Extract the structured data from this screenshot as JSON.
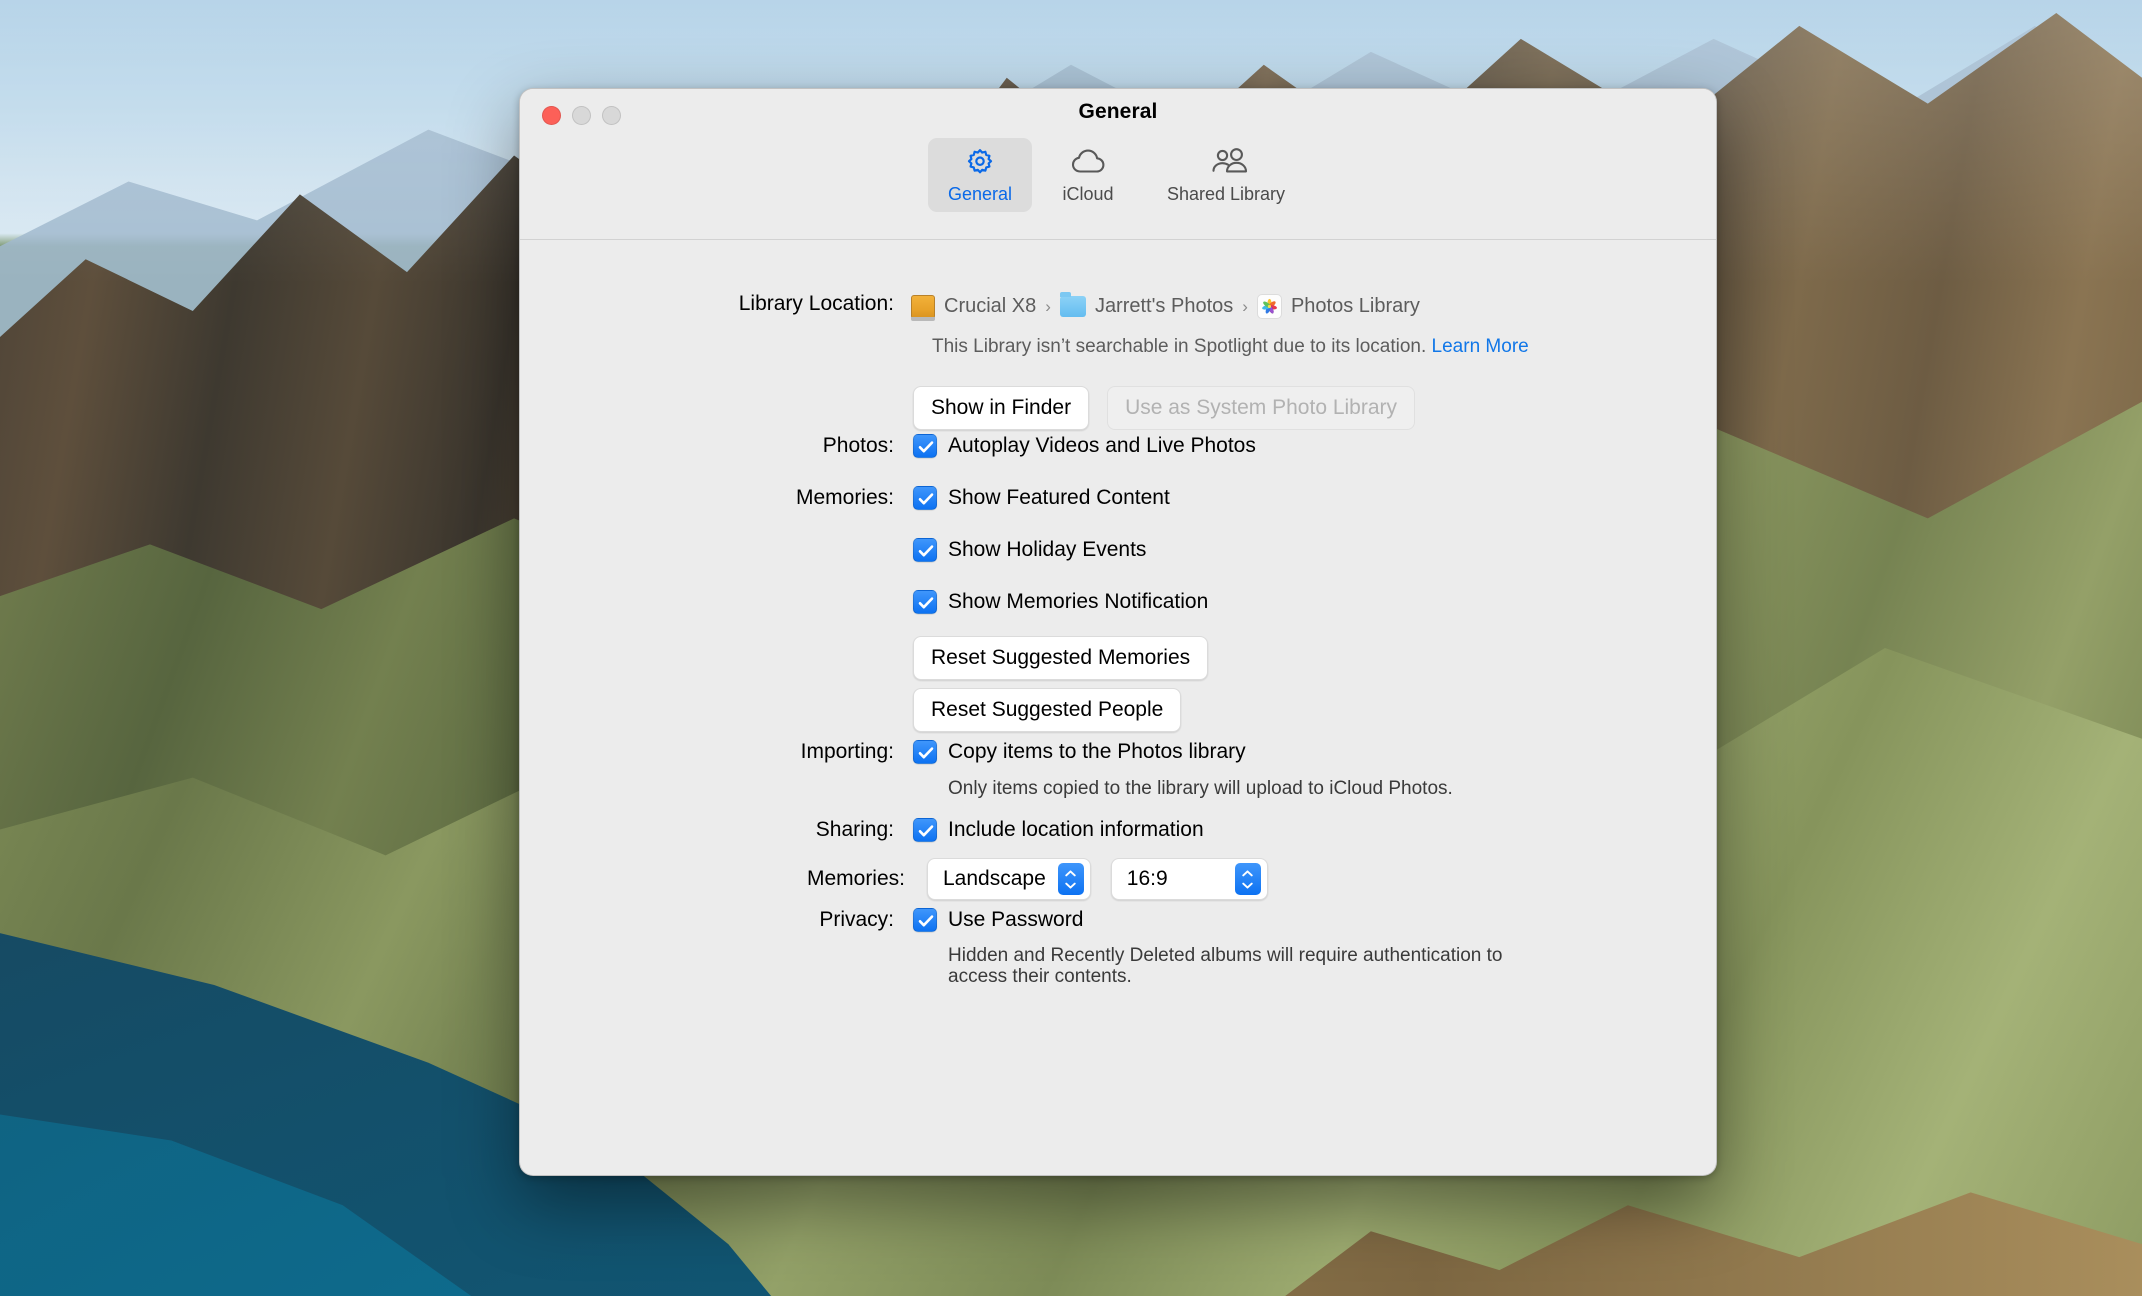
{
  "window": {
    "title": "General",
    "traffic_lights": [
      "close",
      "minimize",
      "zoom"
    ]
  },
  "toolbar": {
    "tabs": [
      {
        "id": "general",
        "label": "General",
        "icon": "gear-icon",
        "selected": true
      },
      {
        "id": "icloud",
        "label": "iCloud",
        "icon": "cloud-icon",
        "selected": false
      },
      {
        "id": "shared-library",
        "label": "Shared Library",
        "icon": "people-icon",
        "selected": false
      }
    ]
  },
  "library_location": {
    "label": "Library Location:",
    "breadcrumb": [
      {
        "name": "Crucial X8",
        "icon": "external-drive-icon"
      },
      {
        "name": "Jarrett's Photos",
        "icon": "folder-icon"
      },
      {
        "name": "Photos Library",
        "icon": "photos-app-icon"
      }
    ],
    "separator": "›",
    "note": "This Library isn’t searchable in Spotlight due to its location.",
    "note_link": "Learn More",
    "buttons": {
      "show_in_finder": "Show in Finder",
      "use_as_system": "Use as System Photo Library",
      "use_as_system_disabled": true
    }
  },
  "photos": {
    "label": "Photos:",
    "autoplay": {
      "text": "Autoplay Videos and Live Photos",
      "checked": true
    }
  },
  "memories": {
    "label": "Memories:",
    "items": [
      {
        "text": "Show Featured Content",
        "checked": true
      },
      {
        "text": "Show Holiday Events",
        "checked": true
      },
      {
        "text": "Show Memories Notification",
        "checked": true
      }
    ],
    "reset_memories_button": "Reset Suggested Memories",
    "reset_people_button": "Reset Suggested People"
  },
  "importing": {
    "label": "Importing:",
    "copy_items": {
      "text": "Copy items to the Photos library",
      "checked": true
    },
    "note": "Only items copied to the library will upload to iCloud Photos."
  },
  "sharing": {
    "label": "Sharing:",
    "include_location": {
      "text": "Include location information",
      "checked": true
    },
    "memories_label": "Memories:",
    "orientation_value": "Landscape",
    "aspect_value": "16:9"
  },
  "privacy": {
    "label": "Privacy:",
    "use_password": {
      "text": "Use Password",
      "checked": true
    },
    "note_line1": "Hidden and Recently Deleted albums will require authentication to",
    "note_line2": "access their contents."
  },
  "colors": {
    "accent_blue": "#0d72f2",
    "link_blue": "#1177e8",
    "selected_tab_label": "#0a69e8",
    "window_bg": "#ececec",
    "close_button": "#fc6058",
    "inactive_light": "#d8d8d8",
    "drive_orange": "#e8a22a",
    "folder_blue": "#64bdf0"
  }
}
